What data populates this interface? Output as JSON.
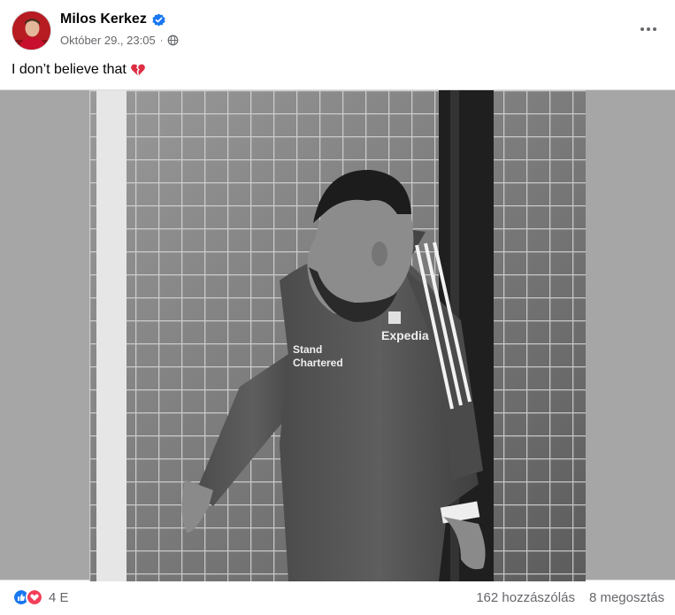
{
  "post": {
    "author": "Milos Kerkez",
    "timestamp": "Október 29., 23:05",
    "separator": "·",
    "caption": "I don’t believe that",
    "caption_emoji": "broken-heart-icon",
    "verified_badge": "verified-badge-icon",
    "privacy_icon": "globe-icon"
  },
  "photo": {
    "sponsor_top": "Expedia",
    "chest_lines": [
      "Stand",
      "Chartered"
    ]
  },
  "footer": {
    "reaction_icons": [
      "like-icon",
      "love-icon"
    ],
    "reaction_count": "4 E",
    "comments": "162 hozzászólás",
    "shares": "8 megosztás"
  },
  "colors": {
    "accent_blue": "#1877f2",
    "love_red": "#f33e58",
    "secondary_text": "#65676b",
    "media_bg": "#a6a6a6"
  }
}
